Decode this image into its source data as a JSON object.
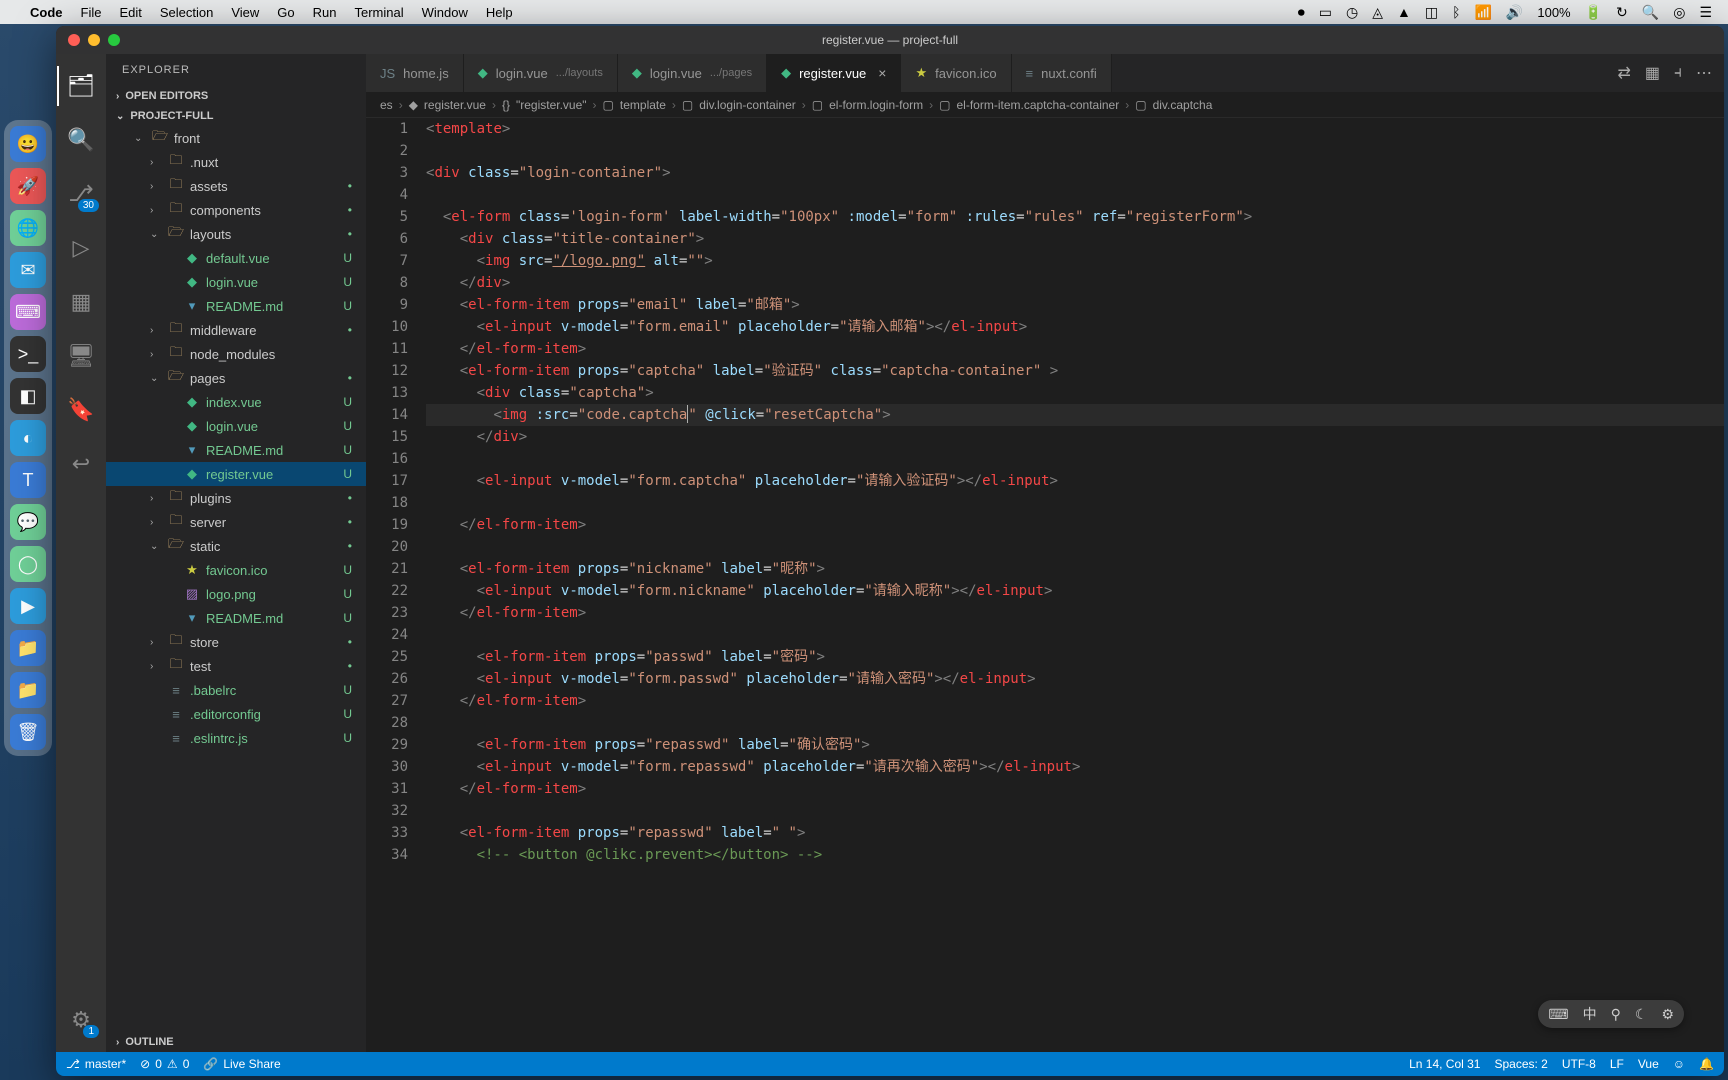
{
  "mac_menu": {
    "app": "Code",
    "items": [
      "File",
      "Edit",
      "Selection",
      "View",
      "Go",
      "Run",
      "Terminal",
      "Window",
      "Help"
    ],
    "right": {
      "battery": "100%",
      "time": ""
    }
  },
  "window_title": "register.vue — project-full",
  "activity": {
    "items": [
      {
        "name": "explorer",
        "glyph": "🗂",
        "active": true
      },
      {
        "name": "search",
        "glyph": "🔍"
      },
      {
        "name": "scm",
        "glyph": "⎇",
        "badge": "30"
      },
      {
        "name": "debug",
        "glyph": "▷"
      },
      {
        "name": "extensions",
        "glyph": "▦"
      },
      {
        "name": "remote",
        "glyph": "🖥"
      },
      {
        "name": "bookmark",
        "glyph": "🔖"
      },
      {
        "name": "revert",
        "glyph": "↩"
      }
    ],
    "bottom": [
      {
        "name": "settings",
        "glyph": "⚙",
        "badge": "1"
      }
    ]
  },
  "explorer": {
    "title": "EXPLORER",
    "sections": {
      "open_editors": "OPEN EDITORS",
      "project": "PROJECT-FULL",
      "outline": "OUTLINE"
    },
    "tree": [
      {
        "type": "folder",
        "label": "front",
        "indent": 1,
        "open": true
      },
      {
        "type": "folder",
        "label": ".nuxt",
        "indent": 2
      },
      {
        "type": "folder",
        "label": "assets",
        "indent": 2,
        "scm": "•"
      },
      {
        "type": "folder",
        "label": "components",
        "indent": 2,
        "scm": "•"
      },
      {
        "type": "folder",
        "label": "layouts",
        "indent": 2,
        "open": true,
        "scm": "•"
      },
      {
        "type": "file",
        "label": "default.vue",
        "indent": 3,
        "icon": "vue",
        "scm": "U",
        "class": "untracked"
      },
      {
        "type": "file",
        "label": "login.vue",
        "indent": 3,
        "icon": "vue",
        "scm": "U",
        "class": "untracked"
      },
      {
        "type": "file",
        "label": "README.md",
        "indent": 3,
        "icon": "md",
        "scm": "U",
        "class": "untracked"
      },
      {
        "type": "folder",
        "label": "middleware",
        "indent": 2,
        "scm": "•"
      },
      {
        "type": "folder",
        "label": "node_modules",
        "indent": 2
      },
      {
        "type": "folder",
        "label": "pages",
        "indent": 2,
        "open": true,
        "scm": "•"
      },
      {
        "type": "file",
        "label": "index.vue",
        "indent": 3,
        "icon": "vue",
        "scm": "U",
        "class": "untracked"
      },
      {
        "type": "file",
        "label": "login.vue",
        "indent": 3,
        "icon": "vue",
        "scm": "U",
        "class": "untracked"
      },
      {
        "type": "file",
        "label": "README.md",
        "indent": 3,
        "icon": "md",
        "scm": "U",
        "class": "untracked"
      },
      {
        "type": "file",
        "label": "register.vue",
        "indent": 3,
        "icon": "vue",
        "scm": "U",
        "class": "untracked",
        "selected": true
      },
      {
        "type": "folder",
        "label": "plugins",
        "indent": 2,
        "scm": "•"
      },
      {
        "type": "folder",
        "label": "server",
        "indent": 2,
        "scm": "•"
      },
      {
        "type": "folder",
        "label": "static",
        "indent": 2,
        "open": true,
        "scm": "•"
      },
      {
        "type": "file",
        "label": "favicon.ico",
        "indent": 3,
        "icon": "fav",
        "scm": "U",
        "class": "untracked"
      },
      {
        "type": "file",
        "label": "logo.png",
        "indent": 3,
        "icon": "img",
        "scm": "U",
        "class": "untracked"
      },
      {
        "type": "file",
        "label": "README.md",
        "indent": 3,
        "icon": "md",
        "scm": "U",
        "class": "untracked"
      },
      {
        "type": "folder",
        "label": "store",
        "indent": 2,
        "scm": "•"
      },
      {
        "type": "folder",
        "label": "test",
        "indent": 2,
        "scm": "•"
      },
      {
        "type": "file",
        "label": ".babelrc",
        "indent": 2,
        "icon": "txt",
        "scm": "U",
        "class": "untracked"
      },
      {
        "type": "file",
        "label": ".editorconfig",
        "indent": 2,
        "icon": "txt",
        "scm": "U",
        "class": "untracked"
      },
      {
        "type": "file",
        "label": ".eslintrc.js",
        "indent": 2,
        "icon": "txt",
        "scm": "U",
        "class": "untracked"
      }
    ]
  },
  "tabs": [
    {
      "icon": "js",
      "label": "home.js"
    },
    {
      "icon": "vue",
      "label": "login.vue",
      "suffix": ".../layouts"
    },
    {
      "icon": "vue",
      "label": "login.vue",
      "suffix": ".../pages"
    },
    {
      "icon": "vue",
      "label": "register.vue",
      "active": true,
      "close": true
    },
    {
      "icon": "fav",
      "label": "favicon.ico"
    },
    {
      "icon": "txt",
      "label": "nuxt.confi"
    }
  ],
  "breadcrumb": [
    {
      "icon": "",
      "label": "es"
    },
    {
      "icon": "◆",
      "label": "register.vue"
    },
    {
      "icon": "{}",
      "label": "\"register.vue\""
    },
    {
      "icon": "▢",
      "label": "template"
    },
    {
      "icon": "▢",
      "label": "div.login-container"
    },
    {
      "icon": "▢",
      "label": "el-form.login-form"
    },
    {
      "icon": "▢",
      "label": "el-form-item.captcha-container"
    },
    {
      "icon": "▢",
      "label": "div.captcha"
    }
  ],
  "code": {
    "lines": [
      {
        "n": 1,
        "html": "<span class='tok-punc'>&lt;</span><span class='tok-tag'>template</span><span class='tok-punc'>&gt;</span>"
      },
      {
        "n": 2,
        "html": ""
      },
      {
        "n": 3,
        "html": "<span class='tok-punc'>&lt;</span><span class='tok-tag'>div</span> <span class='tok-attr'>class</span>=<span class='tok-str'>\"login-container\"</span><span class='tok-punc'>&gt;</span>"
      },
      {
        "n": 4,
        "html": ""
      },
      {
        "n": 5,
        "html": "  <span class='tok-punc'>&lt;</span><span class='tok-tag'>el-form</span> <span class='tok-attr'>class</span>=<span class='tok-str'>'login-form'</span> <span class='tok-attr'>label-width</span>=<span class='tok-str'>\"100px\"</span> <span class='tok-attr'>:model</span>=<span class='tok-str'>\"form\"</span> <span class='tok-attr'>:rules</span>=<span class='tok-str'>\"rules\"</span> <span class='tok-attr'>ref</span>=<span class='tok-str'>\"registerForm\"</span><span class='tok-punc'>&gt;</span>"
      },
      {
        "n": 6,
        "html": "    <span class='tok-punc'>&lt;</span><span class='tok-tag'>div</span> <span class='tok-attr'>class</span>=<span class='tok-str'>\"title-container\"</span><span class='tok-punc'>&gt;</span>"
      },
      {
        "n": 7,
        "html": "      <span class='tok-punc'>&lt;</span><span class='tok-tag'>img</span> <span class='tok-attr'>src</span>=<span class='tok-str underline'>\"/logo.png\"</span> <span class='tok-attr'>alt</span>=<span class='tok-str'>\"\"</span><span class='tok-punc'>&gt;</span>"
      },
      {
        "n": 8,
        "html": "    <span class='tok-punc'>&lt;/</span><span class='tok-tag'>div</span><span class='tok-punc'>&gt;</span>"
      },
      {
        "n": 9,
        "html": "    <span class='tok-punc'>&lt;</span><span class='tok-tag'>el-form-item</span> <span class='tok-attr'>props</span>=<span class='tok-str'>\"email\"</span> <span class='tok-attr'>label</span>=<span class='tok-str'>\"邮箱\"</span><span class='tok-punc'>&gt;</span>"
      },
      {
        "n": 10,
        "html": "      <span class='tok-punc'>&lt;</span><span class='tok-tag'>el-input</span> <span class='tok-attr'>v-model</span>=<span class='tok-str'>\"form.email\"</span> <span class='tok-attr'>placeholder</span>=<span class='tok-str'>\"请输入邮箱\"</span><span class='tok-punc'>&gt;&lt;/</span><span class='tok-tag'>el-input</span><span class='tok-punc'>&gt;</span>"
      },
      {
        "n": 11,
        "html": "    <span class='tok-punc'>&lt;/</span><span class='tok-tag'>el-form-item</span><span class='tok-punc'>&gt;</span>"
      },
      {
        "n": 12,
        "html": "    <span class='tok-punc'>&lt;</span><span class='tok-tag'>el-form-item</span> <span class='tok-attr'>props</span>=<span class='tok-str'>\"captcha\"</span> <span class='tok-attr'>label</span>=<span class='tok-str'>\"验证码\"</span> <span class='tok-attr'>class</span>=<span class='tok-str'>\"captcha-container\"</span> <span class='tok-punc'>&gt;</span>"
      },
      {
        "n": 13,
        "html": "      <span class='tok-punc'>&lt;</span><span class='tok-tag'>div</span> <span class='tok-attr'>class</span>=<span class='tok-str'>\"captcha\"</span><span class='tok-punc'>&gt;</span>"
      },
      {
        "n": 14,
        "html": "        <span class='tok-punc'>&lt;</span><span class='tok-tag'>img</span> <span class='tok-attr'>:src</span>=<span class='tok-str'>\"code.captcha<span class='cursor'></span>\"</span> <span class='tok-attr'>@click</span>=<span class='tok-str'>\"resetCaptcha\"</span><span class='tok-punc'>&gt;</span>",
        "current": true
      },
      {
        "n": 15,
        "html": "      <span class='tok-punc'>&lt;/</span><span class='tok-tag'>div</span><span class='tok-punc'>&gt;</span>"
      },
      {
        "n": 16,
        "html": ""
      },
      {
        "n": 17,
        "html": "      <span class='tok-punc'>&lt;</span><span class='tok-tag'>el-input</span> <span class='tok-attr'>v-model</span>=<span class='tok-str'>\"form.captcha\"</span> <span class='tok-attr'>placeholder</span>=<span class='tok-str'>\"请输入验证码\"</span><span class='tok-punc'>&gt;&lt;/</span><span class='tok-tag'>el-input</span><span class='tok-punc'>&gt;</span>"
      },
      {
        "n": 18,
        "html": ""
      },
      {
        "n": 19,
        "html": "    <span class='tok-punc'>&lt;/</span><span class='tok-tag'>el-form-item</span><span class='tok-punc'>&gt;</span>"
      },
      {
        "n": 20,
        "html": ""
      },
      {
        "n": 21,
        "html": "    <span class='tok-punc'>&lt;</span><span class='tok-tag'>el-form-item</span> <span class='tok-attr'>props</span>=<span class='tok-str'>\"nickname\"</span> <span class='tok-attr'>label</span>=<span class='tok-str'>\"昵称\"</span><span class='tok-punc'>&gt;</span>"
      },
      {
        "n": 22,
        "html": "      <span class='tok-punc'>&lt;</span><span class='tok-tag'>el-input</span> <span class='tok-attr'>v-model</span>=<span class='tok-str'>\"form.nickname\"</span> <span class='tok-attr'>placeholder</span>=<span class='tok-str'>\"请输入昵称\"</span><span class='tok-punc'>&gt;&lt;/</span><span class='tok-tag'>el-input</span><span class='tok-punc'>&gt;</span>"
      },
      {
        "n": 23,
        "html": "    <span class='tok-punc'>&lt;/</span><span class='tok-tag'>el-form-item</span><span class='tok-punc'>&gt;</span>"
      },
      {
        "n": 24,
        "html": ""
      },
      {
        "n": 25,
        "html": "      <span class='tok-punc'>&lt;</span><span class='tok-tag'>el-form-item</span> <span class='tok-attr'>props</span>=<span class='tok-str'>\"passwd\"</span> <span class='tok-attr'>label</span>=<span class='tok-str'>\"密码\"</span><span class='tok-punc'>&gt;</span>"
      },
      {
        "n": 26,
        "html": "      <span class='tok-punc'>&lt;</span><span class='tok-tag'>el-input</span> <span class='tok-attr'>v-model</span>=<span class='tok-str'>\"form.passwd\"</span> <span class='tok-attr'>placeholder</span>=<span class='tok-str'>\"请输入密码\"</span><span class='tok-punc'>&gt;&lt;/</span><span class='tok-tag'>el-input</span><span class='tok-punc'>&gt;</span>"
      },
      {
        "n": 27,
        "html": "    <span class='tok-punc'>&lt;/</span><span class='tok-tag'>el-form-item</span><span class='tok-punc'>&gt;</span>"
      },
      {
        "n": 28,
        "html": ""
      },
      {
        "n": 29,
        "html": "      <span class='tok-punc'>&lt;</span><span class='tok-tag'>el-form-item</span> <span class='tok-attr'>props</span>=<span class='tok-str'>\"repasswd\"</span> <span class='tok-attr'>label</span>=<span class='tok-str'>\"确认密码\"</span><span class='tok-punc'>&gt;</span>"
      },
      {
        "n": 30,
        "html": "      <span class='tok-punc'>&lt;</span><span class='tok-tag'>el-input</span> <span class='tok-attr'>v-model</span>=<span class='tok-str'>\"form.repasswd\"</span> <span class='tok-attr'>placeholder</span>=<span class='tok-str'>\"请再次输入密码\"</span><span class='tok-punc'>&gt;&lt;/</span><span class='tok-tag'>el-input</span><span class='tok-punc'>&gt;</span>"
      },
      {
        "n": 31,
        "html": "    <span class='tok-punc'>&lt;/</span><span class='tok-tag'>el-form-item</span><span class='tok-punc'>&gt;</span>"
      },
      {
        "n": 32,
        "html": ""
      },
      {
        "n": 33,
        "html": "    <span class='tok-punc'>&lt;</span><span class='tok-tag'>el-form-item</span> <span class='tok-attr'>props</span>=<span class='tok-str'>\"repasswd\"</span> <span class='tok-attr'>label</span>=<span class='tok-str'>\" \"</span><span class='tok-punc'>&gt;</span>"
      },
      {
        "n": 34,
        "html": "      <span class='tok-comment'>&lt;!-- &lt;button @clikc.prevent&gt;&lt;/button&gt; --&gt;</span>"
      }
    ]
  },
  "pill": {
    "icons": [
      "⌨",
      "中",
      "⚲",
      "☾",
      "⚙"
    ]
  },
  "statusbar": {
    "branch": "master*",
    "errors": "0",
    "warnings": "0",
    "live_share": "Live Share",
    "position": "Ln 14, Col 31",
    "spaces": "Spaces: 2",
    "encoding": "UTF-8",
    "eol": "LF",
    "language": "Vue",
    "feedback": "☺",
    "bell": "🔔"
  }
}
